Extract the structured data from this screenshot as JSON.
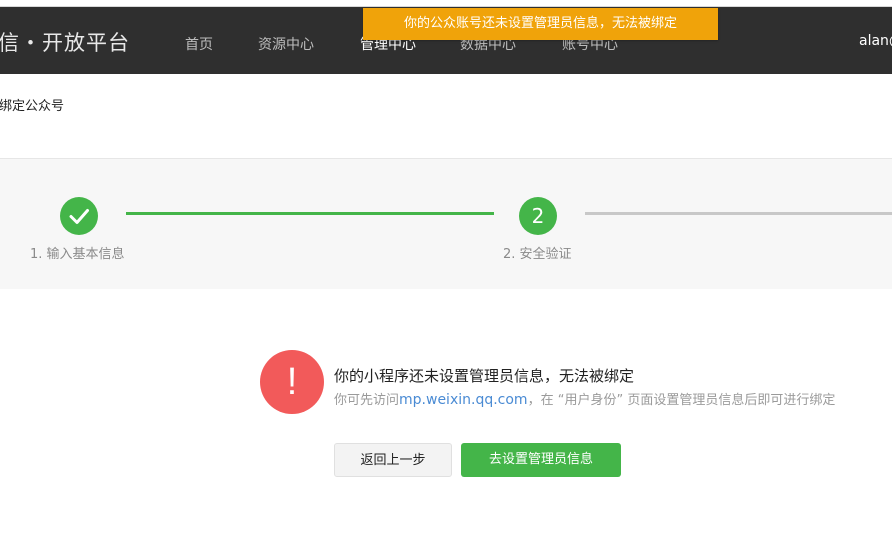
{
  "toast": {
    "message": "你的公众账号还未设置管理员信息，无法被绑定"
  },
  "header": {
    "brand": "信・开放平台",
    "nav": [
      {
        "label": "首页"
      },
      {
        "label": "资源中心"
      },
      {
        "label": "管理中心"
      },
      {
        "label": "数据中心"
      },
      {
        "label": "账号中心"
      }
    ],
    "user": "alan@"
  },
  "breadcrumb": "绑定公众号",
  "steps": [
    {
      "label": "1. 输入基本信息",
      "icon": "check-icon",
      "state": "done"
    },
    {
      "label": "2. 安全验证",
      "number": "2",
      "state": "current"
    }
  ],
  "alert": {
    "icon": "exclamation-icon",
    "title": "你的小程序还未设置管理员信息，无法被绑定",
    "desc_prefix": "你可先访问",
    "desc_link": "mp.weixin.qq.com",
    "desc_suffix": "，在 “用户身份” 页面设置管理员信息后即可进行绑定"
  },
  "buttons": {
    "back": "返回上一步",
    "primary": "去设置管理员信息"
  },
  "colors": {
    "nav_bg": "#2f2f2f",
    "toast_bg": "#f0a30a",
    "accent_green": "#44b549",
    "alert_red": "#f25a5a",
    "link_blue": "#4a8bd4",
    "pending_line": "#c8c8c8"
  }
}
